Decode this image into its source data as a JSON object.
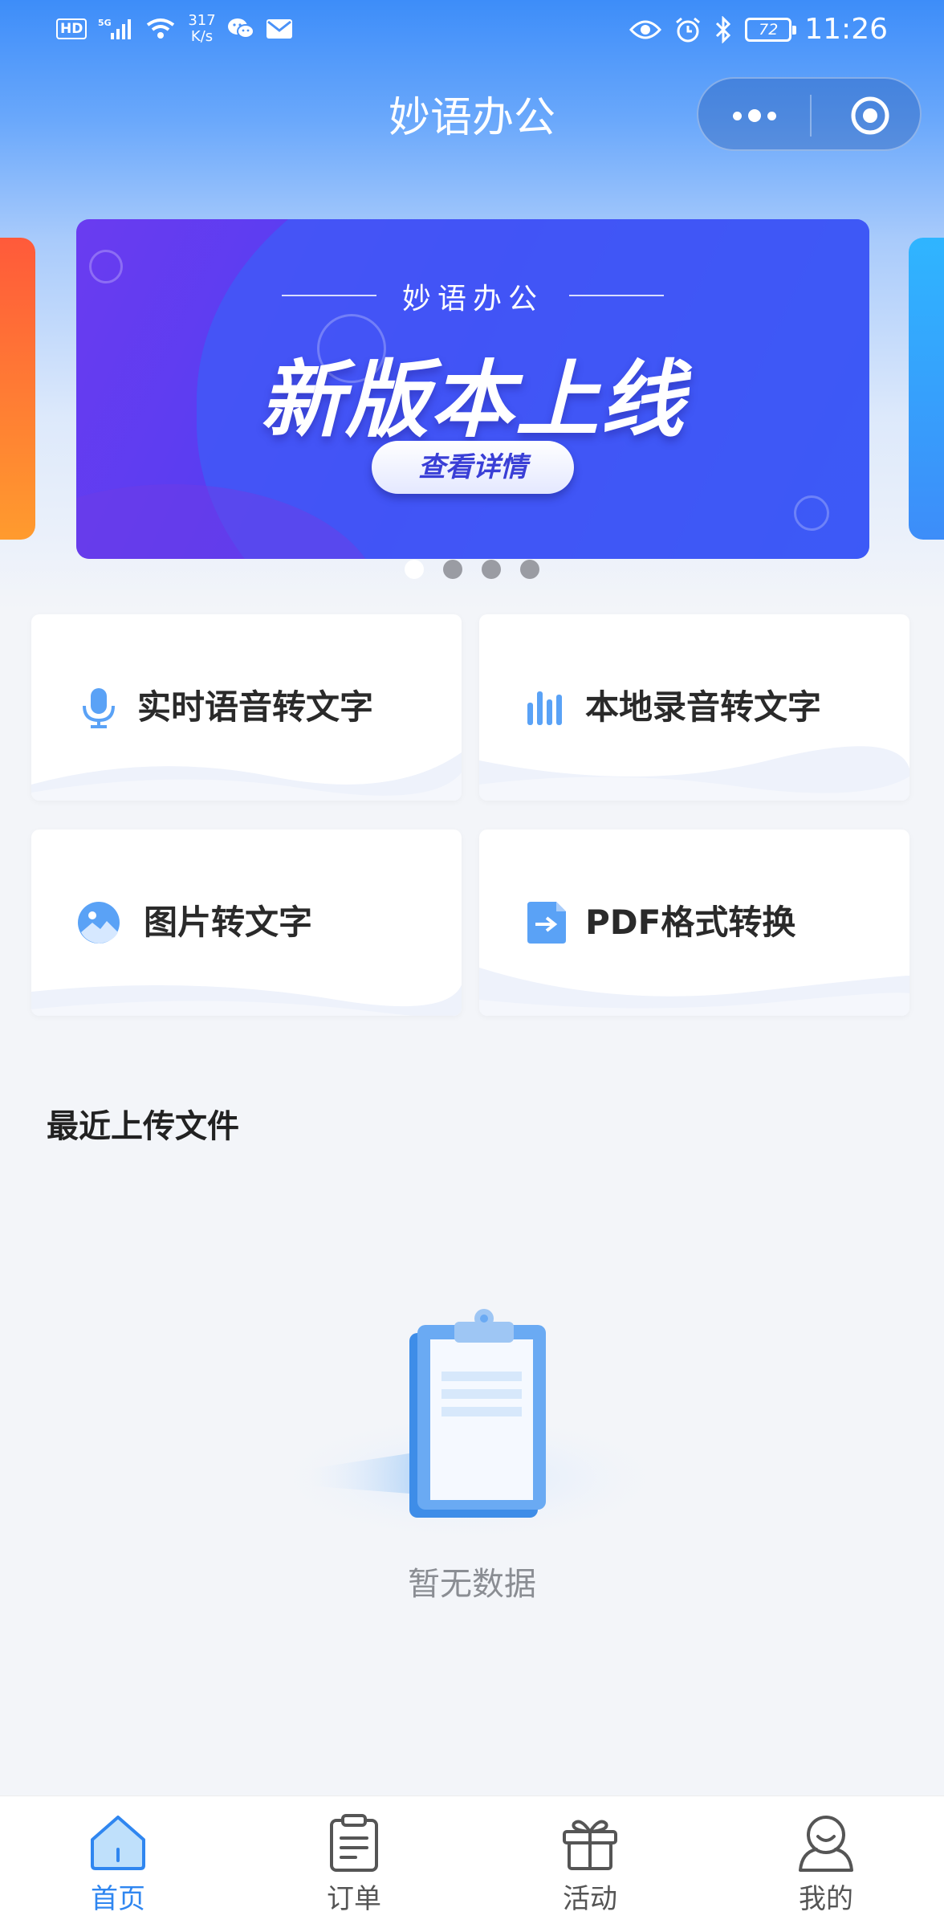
{
  "status_bar": {
    "hd_badge": "HD",
    "signal_label": "5G",
    "net_speed_value": "317",
    "net_speed_unit": "K/s",
    "battery": "72",
    "time": "11:26"
  },
  "header": {
    "title": "妙语办公"
  },
  "banner": {
    "subtitle": "妙语办公",
    "title": "新版本上线",
    "button_label": "查看详情",
    "slide_count": 4,
    "active_slide": 1
  },
  "features": [
    {
      "label": "实时语音转文字",
      "icon": "microphone-icon"
    },
    {
      "label": "本地录音转文字",
      "icon": "audio-bars-icon"
    },
    {
      "label": "图片转文字",
      "icon": "image-icon"
    },
    {
      "label": "PDF格式转换",
      "icon": "pdf-convert-icon"
    }
  ],
  "recent": {
    "title": "最近上传文件",
    "empty_text": "暂无数据"
  },
  "tab_bar": {
    "active": 0,
    "tabs": [
      {
        "label": "首页",
        "icon": "home-icon"
      },
      {
        "label": "订单",
        "icon": "order-icon"
      },
      {
        "label": "活动",
        "icon": "gift-icon"
      },
      {
        "label": "我的",
        "icon": "user-icon"
      }
    ]
  },
  "colors": {
    "accent": "#2f86f0",
    "banner_start": "#6a3cf0",
    "banner_end": "#3b52f5"
  }
}
